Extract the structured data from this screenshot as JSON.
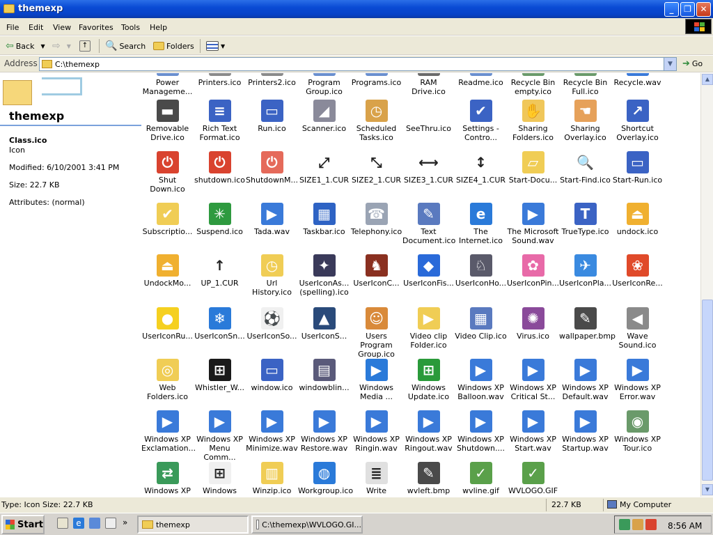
{
  "window": {
    "title": "themexp"
  },
  "menu": [
    "File",
    "Edit",
    "View",
    "Favorites",
    "Tools",
    "Help"
  ],
  "toolbar": {
    "back": "Back",
    "search": "Search",
    "folders": "Folders"
  },
  "address": {
    "label": "Address",
    "value": "C:\\themexp",
    "go": "Go"
  },
  "left_pane": {
    "folder_title": "themexp",
    "selected_name": "Class.ico",
    "selected_type": "Icon",
    "modified": "Modified: 6/10/2001 3:41 PM",
    "size": "Size: 22.7 KB",
    "attributes": "Attributes: (normal)"
  },
  "rows": [
    [
      {
        "label": "Power Manageme...",
        "icon": "power-icon",
        "color": "#6a8fcf"
      },
      {
        "label": "Printers.ico",
        "icon": "printer-icon",
        "color": "#8a8a8a"
      },
      {
        "label": "Printers2.ico",
        "icon": "printer-icon",
        "color": "#8a8a8a"
      },
      {
        "label": "Program Group.ico",
        "icon": "program-group-icon",
        "color": "#6a8fcf"
      },
      {
        "label": "Programs.ico",
        "icon": "programs-icon",
        "color": "#6a8fcf"
      },
      {
        "label": "RAM Drive.ico",
        "icon": "ram-drive-icon",
        "color": "#6a6a6a"
      },
      {
        "label": "Readme.ico",
        "icon": "readme-icon",
        "color": "#6a8fcf"
      },
      {
        "label": "Recycle Bin empty.ico",
        "icon": "recycle-bin-icon",
        "color": "#6a9a6a"
      },
      {
        "label": "Recycle Bin Full.ico",
        "icon": "recycle-bin-icon",
        "color": "#6a9a6a"
      },
      {
        "label": "Recycle.wav",
        "icon": "wav-icon",
        "color": "#3a7ad9"
      }
    ],
    [
      {
        "label": "Removable Drive.ico",
        "icon": "removable-drive-icon",
        "color": "#4a4a4a",
        "glyph": "▬"
      },
      {
        "label": "Rich Text Format.ico",
        "icon": "document-icon",
        "color": "#3b63c4",
        "glyph": "≡"
      },
      {
        "label": "Run.ico",
        "icon": "run-icon",
        "color": "#3b63c4",
        "glyph": "▭"
      },
      {
        "label": "Scanner.ico",
        "icon": "scanner-icon",
        "color": "#8a8a9a",
        "glyph": "◢"
      },
      {
        "label": "Scheduled Tasks.ico",
        "icon": "scheduled-tasks-icon",
        "color": "#d9a24a",
        "glyph": "◷"
      },
      {
        "label": "SeeThru.ico",
        "icon": "seethru-icon",
        "color": "#ffffff",
        "glyph": ""
      },
      {
        "label": "Settings - Contro...",
        "icon": "settings-icon",
        "color": "#3b63c4",
        "glyph": "✔"
      },
      {
        "label": "Sharing Folders.ico",
        "icon": "sharing-folder-icon",
        "color": "#f0c75a",
        "glyph": "✋"
      },
      {
        "label": "Sharing Overlay.ico",
        "icon": "sharing-overlay-icon",
        "color": "#e6a15a",
        "glyph": "☚"
      },
      {
        "label": "Shortcut Overlay.ico",
        "icon": "shortcut-overlay-icon",
        "color": "#3b63c4",
        "glyph": "↗"
      }
    ],
    [
      {
        "label": "Shut Down.ico",
        "icon": "shutdown-icon",
        "color": "#d9432f",
        "glyph": "⏻"
      },
      {
        "label": "shutdown.ico",
        "icon": "shutdown-icon",
        "color": "#d9432f",
        "glyph": "⏻"
      },
      {
        "label": "ShutdownM...",
        "icon": "shutdown-icon",
        "color": "#e56a5a",
        "glyph": "⏻"
      },
      {
        "label": "SIZE1_1.CUR",
        "icon": "cursor-diagonal-icon",
        "color": "#ffffff",
        "glyph": "⤢"
      },
      {
        "label": "SIZE2_1.CUR",
        "icon": "cursor-diagonal-icon",
        "color": "#ffffff",
        "glyph": "⤡"
      },
      {
        "label": "SIZE3_1.CUR",
        "icon": "cursor-horizontal-icon",
        "color": "#ffffff",
        "glyph": "⟷"
      },
      {
        "label": "SIZE4_1.CUR",
        "icon": "cursor-vertical-icon",
        "color": "#ffffff",
        "glyph": "↕"
      },
      {
        "label": "Start-Docu...",
        "icon": "start-documents-icon",
        "color": "#f0cd55",
        "glyph": "▱"
      },
      {
        "label": "Start-Find.ico",
        "icon": "start-find-icon",
        "color": "#ffffff",
        "glyph": "🔍"
      },
      {
        "label": "Start-Run.ico",
        "icon": "start-run-icon",
        "color": "#3b63c4",
        "glyph": "▭"
      }
    ],
    [
      {
        "label": "Subscriptio...",
        "icon": "subscriptions-folder-icon",
        "color": "#f0cd55",
        "glyph": "✔"
      },
      {
        "label": "Suspend.ico",
        "icon": "suspend-icon",
        "color": "#2e9a3f",
        "glyph": "✳"
      },
      {
        "label": "Tada.wav",
        "icon": "wav-icon",
        "color": "#3a7ad9",
        "glyph": "▶"
      },
      {
        "label": "Taskbar.ico",
        "icon": "taskbar-icon",
        "color": "#2e63c4",
        "glyph": "▦"
      },
      {
        "label": "Telephony.ico",
        "icon": "telephony-icon",
        "color": "#9aa4b4",
        "glyph": "☎"
      },
      {
        "label": "Text Document.ico",
        "icon": "text-document-icon",
        "color": "#5a7abf",
        "glyph": "✎"
      },
      {
        "label": "The Internet.ico",
        "icon": "internet-explorer-icon",
        "color": "#2a7ad9",
        "glyph": "e"
      },
      {
        "label": "The Microsoft Sound.wav",
        "icon": "wav-icon",
        "color": "#3a7ad9",
        "glyph": "▶"
      },
      {
        "label": "TrueType.ico",
        "icon": "truetype-icon",
        "color": "#3b63c4",
        "glyph": "T"
      },
      {
        "label": "undock.ico",
        "icon": "undock-icon",
        "color": "#f0b030",
        "glyph": "⏏"
      }
    ],
    [
      {
        "label": "UndockMo...",
        "icon": "undock-icon",
        "color": "#f0b030",
        "glyph": "⏏"
      },
      {
        "label": "UP_1.CUR",
        "icon": "cursor-up-icon",
        "color": "#ffffff",
        "glyph": "↑"
      },
      {
        "label": "Url History.ico",
        "icon": "url-history-icon",
        "color": "#f0cd55",
        "glyph": "◷"
      },
      {
        "label": "UserIconAs... (spelling).ico",
        "icon": "astronaut-icon",
        "color": "#3a3a5a",
        "glyph": "✦"
      },
      {
        "label": "UserIconC...",
        "icon": "chess-icon",
        "color": "#8a3020",
        "glyph": "♞"
      },
      {
        "label": "UserIconFis...",
        "icon": "fish-icon",
        "color": "#2a6ad9",
        "glyph": "◆"
      },
      {
        "label": "UserIconHo...",
        "icon": "horse-icon",
        "color": "#5a5a6a",
        "glyph": "♘"
      },
      {
        "label": "UserIconPin...",
        "icon": "flower-icon",
        "color": "#e86aa8",
        "glyph": "✿"
      },
      {
        "label": "UserIconPla...",
        "icon": "plane-icon",
        "color": "#3a8ae0",
        "glyph": "✈"
      },
      {
        "label": "UserIconRe...",
        "icon": "red-flower-icon",
        "color": "#e04a2a",
        "glyph": "❀"
      }
    ],
    [
      {
        "label": "UserIconRu...",
        "icon": "rubber-duck-icon",
        "color": "#f5d020",
        "glyph": "●"
      },
      {
        "label": "UserIconSn...",
        "icon": "snowflake-icon",
        "color": "#2a7ad9",
        "glyph": "❄"
      },
      {
        "label": "UserIconSo...",
        "icon": "soccer-ball-icon",
        "color": "#f0f0f0",
        "glyph": "⚽"
      },
      {
        "label": "UserIconS...",
        "icon": "shuttle-icon",
        "color": "#2a4a7a",
        "glyph": "▲"
      },
      {
        "label": "Users Program Group.ico",
        "icon": "users-icon",
        "color": "#d98a3a",
        "glyph": "☺"
      },
      {
        "label": "Video clip Folder.ico",
        "icon": "video-folder-icon",
        "color": "#f0cd55",
        "glyph": "▶"
      },
      {
        "label": "Video Clip.ico",
        "icon": "video-clip-icon",
        "color": "#5a7abf",
        "glyph": "▦"
      },
      {
        "label": "Virus.ico",
        "icon": "virus-icon",
        "color": "#8a4a9a",
        "glyph": "✺"
      },
      {
        "label": "wallpaper.bmp",
        "icon": "paint-icon",
        "color": "#4a4a4a",
        "glyph": "✎"
      },
      {
        "label": "Wave Sound.ico",
        "icon": "speaker-icon",
        "color": "#8a8a8a",
        "glyph": "◀"
      }
    ],
    [
      {
        "label": "Web Folders.ico",
        "icon": "web-folder-icon",
        "color": "#f0cd55",
        "glyph": "◎"
      },
      {
        "label": "Whistler_W...",
        "icon": "windows-logo-icon",
        "color": "#1a1a1a",
        "glyph": "⊞"
      },
      {
        "label": "window.ico",
        "icon": "window-icon",
        "color": "#3b63c4",
        "glyph": "▭"
      },
      {
        "label": "windowblin...",
        "icon": "windowblinds-icon",
        "color": "#5a5a7a",
        "glyph": "▤"
      },
      {
        "label": "Windows Media ...",
        "icon": "media-player-icon",
        "color": "#2a7ad9",
        "glyph": "▶"
      },
      {
        "label": "Windows Update.ico",
        "icon": "windows-update-icon",
        "color": "#2a9a3a",
        "glyph": "⊞"
      },
      {
        "label": "Windows XP Balloon.wav",
        "icon": "wav-icon",
        "color": "#3a7ad9",
        "glyph": "▶"
      },
      {
        "label": "Windows XP Critical St...",
        "icon": "wav-icon",
        "color": "#3a7ad9",
        "glyph": "▶"
      },
      {
        "label": "Windows XP Default.wav",
        "icon": "wav-icon",
        "color": "#3a7ad9",
        "glyph": "▶"
      },
      {
        "label": "Windows XP Error.wav",
        "icon": "wav-icon",
        "color": "#3a7ad9",
        "glyph": "▶"
      }
    ],
    [
      {
        "label": "Windows XP Exclamation...",
        "icon": "wav-icon",
        "color": "#3a7ad9",
        "glyph": "▶"
      },
      {
        "label": "Windows XP Menu Comm...",
        "icon": "wav-icon",
        "color": "#3a7ad9",
        "glyph": "▶"
      },
      {
        "label": "Windows XP Minimize.wav",
        "icon": "wav-icon",
        "color": "#3a7ad9",
        "glyph": "▶"
      },
      {
        "label": "Windows XP Restore.wav",
        "icon": "wav-icon",
        "color": "#3a7ad9",
        "glyph": "▶"
      },
      {
        "label": "Windows XP Ringin.wav",
        "icon": "wav-icon",
        "color": "#3a7ad9",
        "glyph": "▶"
      },
      {
        "label": "Windows XP Ringout.wav",
        "icon": "wav-icon",
        "color": "#3a7ad9",
        "glyph": "▶"
      },
      {
        "label": "Windows XP Shutdown....",
        "icon": "wav-icon",
        "color": "#3a7ad9",
        "glyph": "▶"
      },
      {
        "label": "Windows XP Start.wav",
        "icon": "wav-icon",
        "color": "#3a7ad9",
        "glyph": "▶"
      },
      {
        "label": "Windows XP Startup.wav",
        "icon": "wav-icon",
        "color": "#3a7ad9",
        "glyph": "▶"
      },
      {
        "label": "Windows XP Tour.ico",
        "icon": "tour-icon",
        "color": "#6a9a6a",
        "glyph": "◉"
      }
    ],
    [
      {
        "label": "Windows XP",
        "icon": "network-icon",
        "color": "#3a9a5a",
        "glyph": "⇄"
      },
      {
        "label": "Windows",
        "icon": "windows-doc-icon",
        "color": "#f0f0f0",
        "glyph": "⊞"
      },
      {
        "label": "Winzip.ico",
        "icon": "winzip-icon",
        "color": "#f0cd55",
        "glyph": "▥"
      },
      {
        "label": "Workgroup.ico",
        "icon": "workgroup-icon",
        "color": "#2a7ad9",
        "glyph": "◍"
      },
      {
        "label": "Write",
        "icon": "write-icon",
        "color": "#e0e0e0",
        "glyph": "≣"
      },
      {
        "label": "wvleft.bmp",
        "icon": "paint-icon",
        "color": "#4a4a4a",
        "glyph": "✎"
      },
      {
        "label": "wvline.gif",
        "icon": "image-icon",
        "color": "#5aa04a",
        "glyph": "✓"
      },
      {
        "label": "WVLOGO.GIF",
        "icon": "image-icon",
        "color": "#5aa04a",
        "glyph": "✓"
      }
    ]
  ],
  "status": {
    "left": "Type: Icon Size: 22.7 KB",
    "size": "22.7 KB",
    "location": "My Computer"
  },
  "taskbar": {
    "start": "Start",
    "tasks": [
      "themexp",
      "C:\\themexp\\WVLOGO.GI..."
    ],
    "clock": "8:56 AM",
    "overflow": "»"
  }
}
